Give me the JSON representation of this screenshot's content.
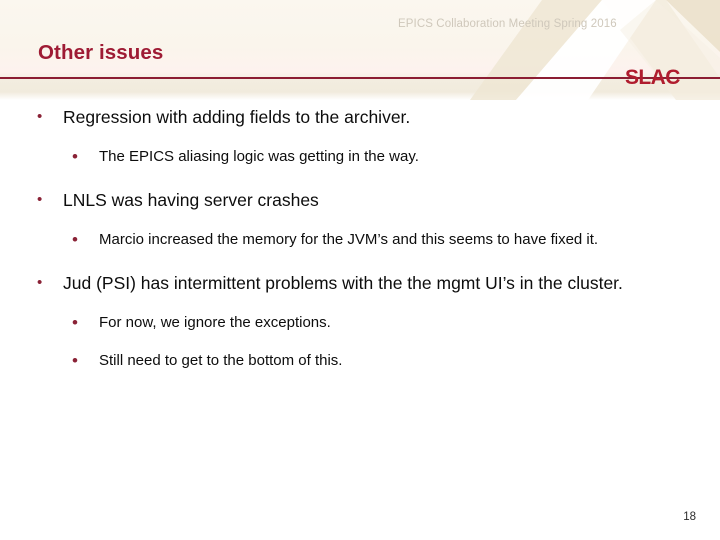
{
  "slide": {
    "meeting_label": "EPICS Collaboration Meeting Spring 2016",
    "title": "Other issues",
    "logo_text": "SLAC",
    "page_number": "18",
    "colors": {
      "accent_maroon": "#8c1d33",
      "title_crimson": "#9e1b34",
      "logo_red": "#b01c2e",
      "bullet_marker": "#8a2236",
      "header_cream": "#faf5ec",
      "meeting_gray": "#cfc8bb",
      "body_text": "#0d0d0d"
    }
  },
  "bullets": [
    {
      "level": 1,
      "marker": "•",
      "text": "Regression with adding fields to the archiver."
    },
    {
      "level": 2,
      "marker": "•",
      "text": "The EPICS aliasing logic was getting in the way."
    },
    {
      "level": 1,
      "marker": "•",
      "text": "LNLS was having server crashes"
    },
    {
      "level": 2,
      "marker": "•",
      "text": "Marcio increased the memory for the JVM’s and this seems to have fixed it."
    },
    {
      "level": 1,
      "marker": "•",
      "text": "Jud (PSI) has intermittent problems with the the mgmt UI’s in the cluster."
    },
    {
      "level": 2,
      "marker": "•",
      "text": "For now, we ignore the exceptions."
    },
    {
      "level": 2,
      "marker": "•",
      "text": "Still need to get to the bottom of this."
    }
  ]
}
